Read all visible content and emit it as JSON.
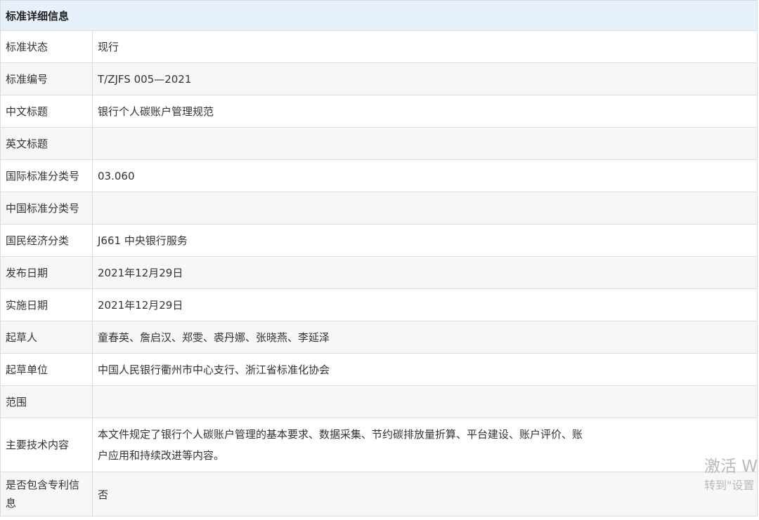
{
  "header": {
    "title": "标准详细信息"
  },
  "rows": [
    {
      "label": "标准状态",
      "value": "现行"
    },
    {
      "label": "标准编号",
      "value": "T/ZJFS 005—2021"
    },
    {
      "label": "中文标题",
      "value": "银行个人碳账户管理规范"
    },
    {
      "label": "英文标题",
      "value": ""
    },
    {
      "label": "国际标准分类号",
      "value": "03.060"
    },
    {
      "label": "中国标准分类号",
      "value": ""
    },
    {
      "label": "国民经济分类",
      "value": "J661 中央银行服务"
    },
    {
      "label": "发布日期",
      "value": "2021年12月29日"
    },
    {
      "label": "实施日期",
      "value": "2021年12月29日"
    },
    {
      "label": "起草人",
      "value": "童春英、詹启汉、郑雯、裘丹娜、张晓燕、李延泽"
    },
    {
      "label": "起草单位",
      "value": "中国人民银行衢州市中心支行、浙江省标准化协会"
    },
    {
      "label": "范围",
      "value": ""
    },
    {
      "label": "主要技术内容",
      "value": "本文件规定了银行个人碳账户管理的基本要求、数据采集、节约碳排放量折算、平台建设、账户评价、账户应用和持续改进等内容。"
    },
    {
      "label": "是否包含专利信息",
      "value": "否"
    }
  ],
  "watermark": {
    "line1": "激活 W",
    "line2": "转到\"设置"
  }
}
